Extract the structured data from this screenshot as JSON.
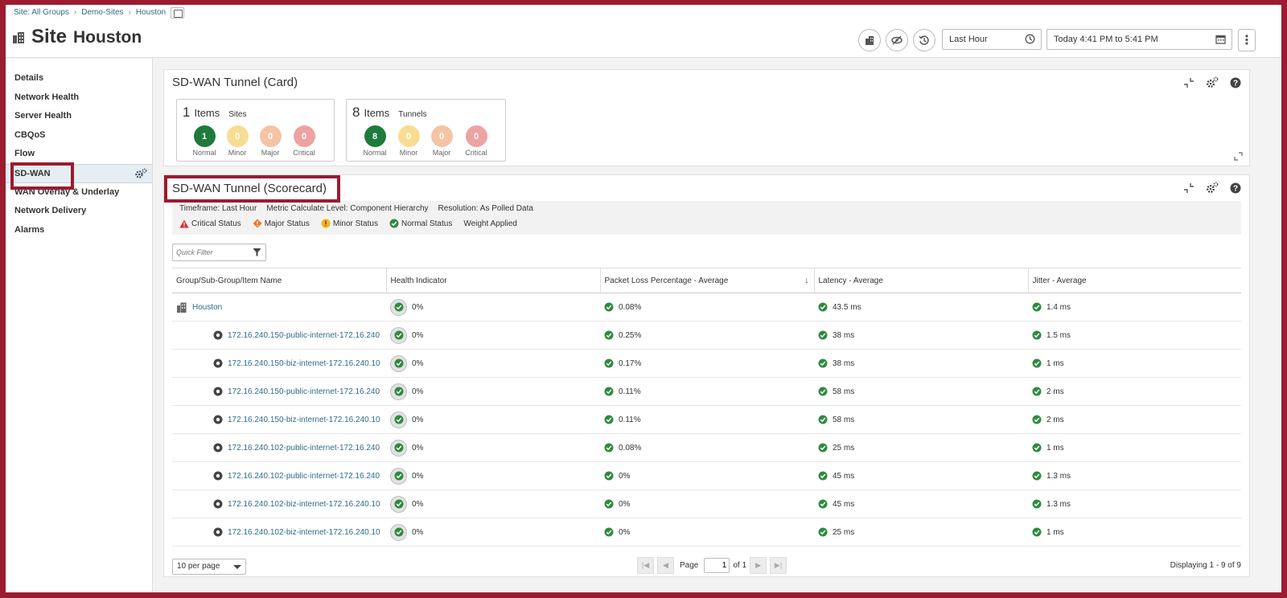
{
  "breadcrumb": [
    "Site: All Groups",
    "Demo-Sites",
    "Houston"
  ],
  "title": {
    "prefix": "Site",
    "name": "Houston"
  },
  "timeframe": {
    "selected": "Last Hour",
    "range": "Today 4:41 PM to 5:41 PM"
  },
  "sidebar": {
    "items": [
      {
        "label": "Details"
      },
      {
        "label": "Network Health"
      },
      {
        "label": "Server Health"
      },
      {
        "label": "CBQoS"
      },
      {
        "label": "Flow"
      },
      {
        "label": "SD-WAN"
      },
      {
        "label": "WAN Overlay & Underlay"
      },
      {
        "label": "Network Delivery"
      },
      {
        "label": "Alarms"
      }
    ],
    "active": "SD-WAN"
  },
  "card_panel": {
    "title": "SD-WAN Tunnel (Card)",
    "cards": [
      {
        "count": "1",
        "items_label": "Items",
        "sub": "Sites",
        "statuses": [
          {
            "value": "1",
            "label": "Normal",
            "color": "#1f7a3c"
          },
          {
            "value": "0",
            "label": "Minor",
            "color": "#f7dd94"
          },
          {
            "value": "0",
            "label": "Major",
            "color": "#f5c3a6"
          },
          {
            "value": "0",
            "label": "Critical",
            "color": "#eda3a3"
          }
        ]
      },
      {
        "count": "8",
        "items_label": "Items",
        "sub": "Tunnels",
        "statuses": [
          {
            "value": "8",
            "label": "Normal",
            "color": "#1f7a3c"
          },
          {
            "value": "0",
            "label": "Minor",
            "color": "#f7dd94"
          },
          {
            "value": "0",
            "label": "Major",
            "color": "#f5c3a6"
          },
          {
            "value": "0",
            "label": "Critical",
            "color": "#eda3a3"
          }
        ]
      }
    ]
  },
  "score_panel": {
    "title": "SD-WAN Tunnel (Scorecard)",
    "meta": [
      "Timeframe: Last Hour",
      "Metric Calculate Level: Component Hierarchy",
      "Resolution: As Polled Data"
    ],
    "legend": {
      "critical": "Critical Status",
      "major": "Major Status",
      "minor": "Minor Status",
      "normal": "Normal Status",
      "weight": "Weight Applied"
    },
    "quick_filter_placeholder": "Quick Filter",
    "columns": [
      "Group/Sub-Group/Item Name",
      "Health Indicator",
      "Packet Loss Percentage - Average",
      "Latency - Average",
      "Jitter - Average"
    ],
    "rows": [
      {
        "name": "Houston",
        "group": true,
        "health": "0%",
        "loss": "0.08%",
        "latency": "43.5 ms",
        "jitter": "1.4 ms"
      },
      {
        "name": "172.16.240.150-public-internet-172.16.240",
        "health": "0%",
        "loss": "0.25%",
        "latency": "38 ms",
        "jitter": "1.5 ms"
      },
      {
        "name": "172.16.240.150-biz-internet-172.16.240.10",
        "health": "0%",
        "loss": "0.17%",
        "latency": "38 ms",
        "jitter": "1 ms"
      },
      {
        "name": "172.16.240.150-public-internet-172.16.240",
        "health": "0%",
        "loss": "0.11%",
        "latency": "58 ms",
        "jitter": "2 ms"
      },
      {
        "name": "172.16.240.150-biz-internet-172.16.240.10",
        "health": "0%",
        "loss": "0.11%",
        "latency": "58 ms",
        "jitter": "2 ms"
      },
      {
        "name": "172.16.240.102-public-internet-172.16.240",
        "health": "0%",
        "loss": "0.08%",
        "latency": "25 ms",
        "jitter": "1 ms"
      },
      {
        "name": "172.16.240.102-public-internet-172.16.240",
        "health": "0%",
        "loss": "0%",
        "latency": "45 ms",
        "jitter": "1.3 ms"
      },
      {
        "name": "172.16.240.102-biz-internet-172.16.240.10",
        "health": "0%",
        "loss": "0%",
        "latency": "45 ms",
        "jitter": "1.3 ms"
      },
      {
        "name": "172.16.240.102-biz-internet-172.16.240.10",
        "health": "0%",
        "loss": "0%",
        "latency": "25 ms",
        "jitter": "1 ms"
      }
    ],
    "pager": {
      "per_page": "10 per page",
      "page_label": "Page",
      "page": "1",
      "of": "of 1",
      "displaying": "Displaying 1 - 9 of 9"
    }
  },
  "colors": {
    "accent": "#9b1b30",
    "normal": "#2e8b3e",
    "link": "#2f6b8a"
  }
}
